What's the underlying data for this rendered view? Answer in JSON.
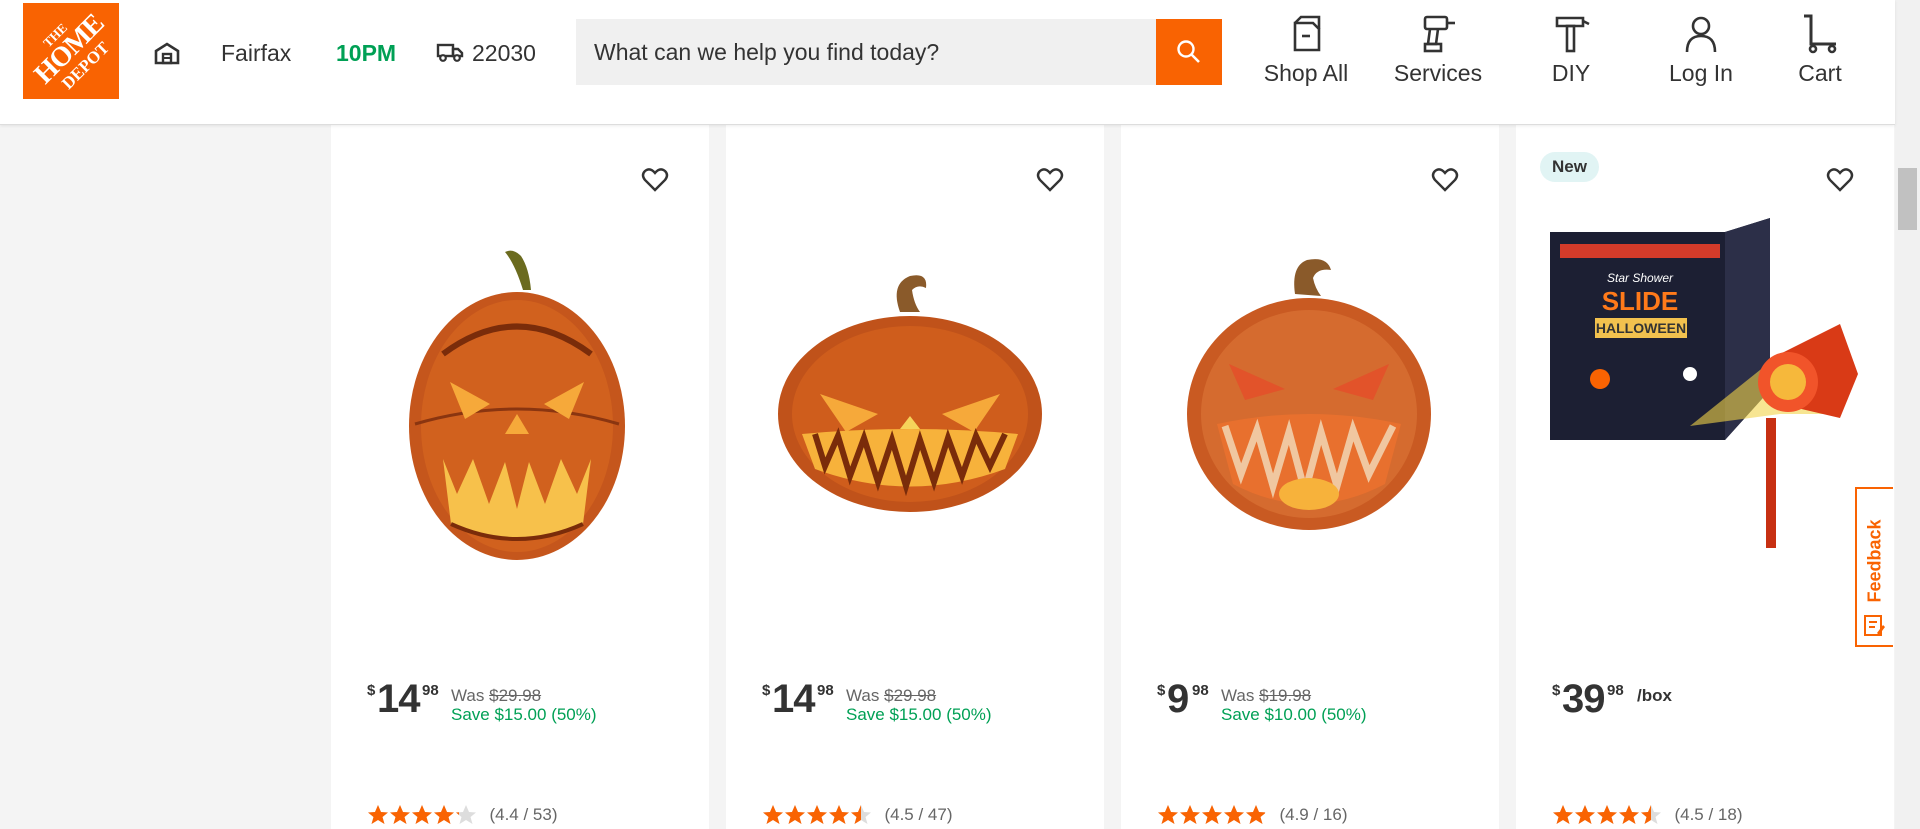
{
  "header": {
    "logo_lines": [
      "THE",
      "HOME",
      "DEPOT"
    ],
    "store": {
      "name": "Fairfax",
      "hours": "10PM"
    },
    "delivery": {
      "zip": "22030"
    },
    "search": {
      "placeholder": "What can we help you find today?"
    },
    "nav": [
      {
        "label": "Shop All",
        "icon": "shop-all-icon"
      },
      {
        "label": "Services",
        "icon": "services-drill-icon"
      },
      {
        "label": "DIY",
        "icon": "diy-hammer-icon"
      },
      {
        "label": "Log In",
        "icon": "user-icon"
      },
      {
        "label": "Cart",
        "icon": "cart-icon"
      }
    ]
  },
  "products": [
    {
      "price_currency": "$",
      "price_dollars": "14",
      "price_cents": "98",
      "was_label": "Was",
      "was_price": "$29.98",
      "save_text": "Save $15.00 (50%)",
      "rating_value": 4.4,
      "rating_text": "(4.4 / 53)",
      "image": "jack-o-lantern-tall-pumpkin"
    },
    {
      "price_currency": "$",
      "price_dollars": "14",
      "price_cents": "98",
      "was_label": "Was",
      "was_price": "$29.98",
      "save_text": "Save $15.00 (50%)",
      "rating_value": 4.5,
      "rating_text": "(4.5 / 47)",
      "image": "jack-o-lantern-wide-pumpkin"
    },
    {
      "price_currency": "$",
      "price_dollars": "9",
      "price_cents": "98",
      "was_label": "Was",
      "was_price": "$19.98",
      "save_text": "Save $10.00 (50%)",
      "rating_value": 4.9,
      "rating_text": "(4.9 / 16)",
      "image": "jack-o-lantern-round-pumpkin"
    },
    {
      "badge": "New",
      "price_currency": "$",
      "price_dollars": "39",
      "price_cents": "98",
      "unit": "/box",
      "rating_value": 4.5,
      "rating_text": "(4.5 / 18)",
      "image": "halloween-projector-box",
      "box_text": {
        "brand": "Star Shower",
        "line1": "SLIDE",
        "line2": "HALLOWEEN"
      }
    }
  ],
  "feedback": {
    "label": "Feedback"
  },
  "colors": {
    "brand": "#f96302",
    "sale": "#00a055",
    "star": "#f96302"
  }
}
